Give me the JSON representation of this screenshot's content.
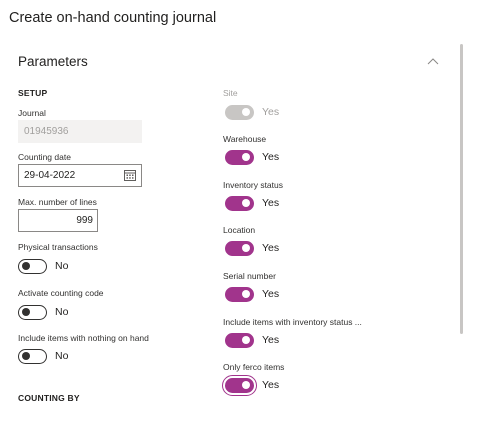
{
  "dialog": {
    "title": "Create on-hand counting journal"
  },
  "panel": {
    "header": "Parameters"
  },
  "setup": {
    "section_label": "SETUP",
    "journal": {
      "label": "Journal",
      "value": "01945936"
    },
    "counting_date": {
      "label": "Counting date",
      "value": "29-04-2022"
    },
    "max_lines": {
      "label": "Max. number of lines",
      "value": "999"
    },
    "physical_transactions": {
      "label": "Physical transactions",
      "value": "No",
      "on": false
    },
    "activate_counting_code": {
      "label": "Activate counting code",
      "value": "No",
      "on": false
    },
    "include_nothing_on_hand": {
      "label": "Include items with nothing on hand",
      "value": "No",
      "on": false
    }
  },
  "right": {
    "site": {
      "label": "Site",
      "value": "Yes",
      "on": true,
      "disabled": true
    },
    "warehouse": {
      "label": "Warehouse",
      "value": "Yes",
      "on": true
    },
    "inventory_status": {
      "label": "Inventory status",
      "value": "Yes",
      "on": true
    },
    "location": {
      "label": "Location",
      "value": "Yes",
      "on": true
    },
    "serial_number": {
      "label": "Serial number",
      "value": "Yes",
      "on": true
    },
    "include_inventory_status": {
      "label": "Include items with inventory status ...",
      "value": "Yes",
      "on": true
    },
    "only_ferco": {
      "label": "Only ferco items",
      "value": "Yes",
      "on": true
    }
  },
  "counting_by": {
    "section_label": "COUNTING BY"
  },
  "colors": {
    "accent": "#a1348c",
    "disabled": "#c8c6c4",
    "text": "#201f1e"
  },
  "icons": {
    "collapse": "chevron-up-icon",
    "calendar": "calendar-icon"
  }
}
